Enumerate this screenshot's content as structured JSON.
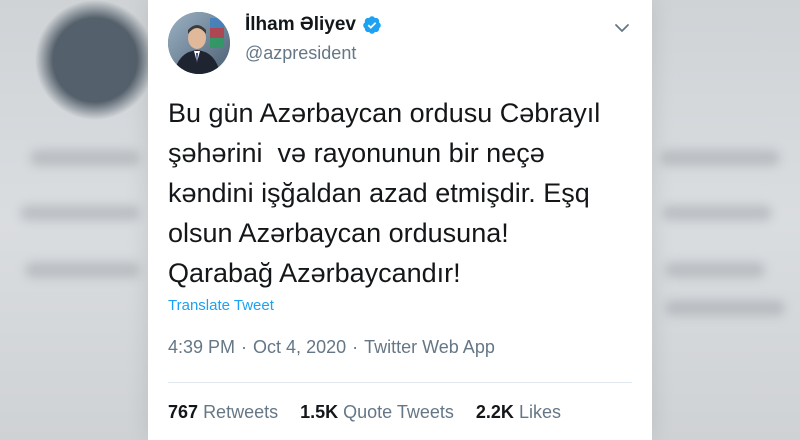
{
  "tweet": {
    "display_name": "İlham Əliyev",
    "handle": "@azpresident",
    "text": "Bu gün Azərbaycan ordusu Cəbrayıl\nşəhərini  və rayonunun bir neçə\nkəndini işğaldan azad etmişdir. Eşq\nolsun Azərbaycan ordusuna!\nQarabağ Azərbaycandır!",
    "translate_label": "Translate Tweet",
    "time": "4:39 PM",
    "date": "Oct 4, 2020",
    "source": "Twitter Web App",
    "separator": "·"
  },
  "stats": {
    "retweets_count": "767",
    "retweets_label": "Retweets",
    "quote_count": "1.5K",
    "quote_label": "Quote Tweets",
    "likes_count": "2.2K",
    "likes_label": "Likes"
  },
  "colors": {
    "accent": "#1da1f2",
    "text": "#14171a",
    "secondary": "#657786"
  },
  "icons": {
    "verified": "verified-badge-icon",
    "menu": "chevron-down-icon"
  }
}
